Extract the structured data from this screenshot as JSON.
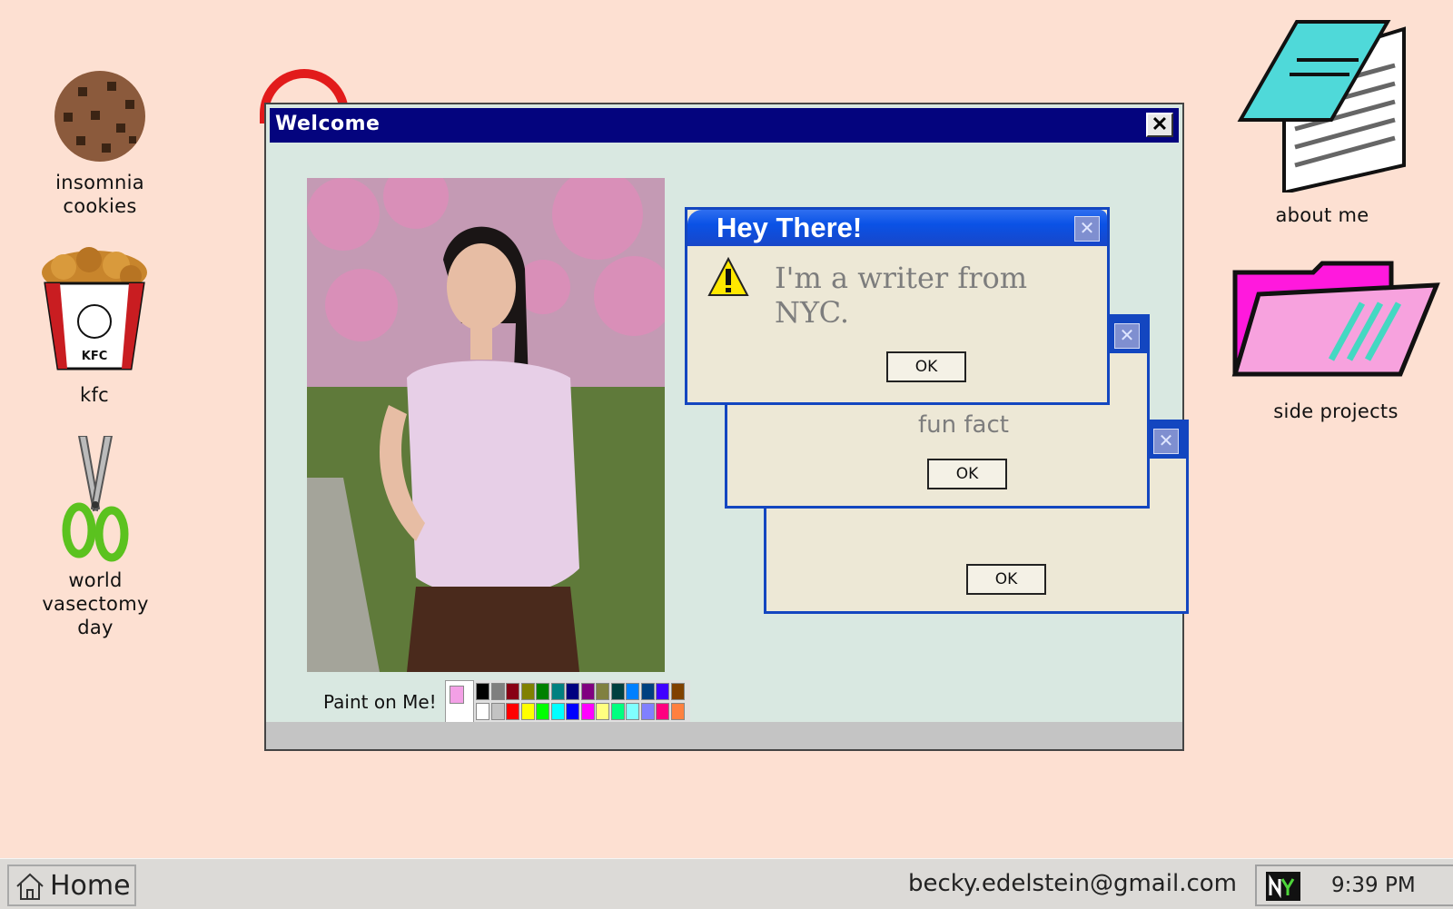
{
  "desktop_icons": {
    "cookies": {
      "label_line1": "insomnia",
      "label_line2": "cookies"
    },
    "kfc": {
      "label": "kfc",
      "bucket_text": "KFC"
    },
    "vasectomy": {
      "label_line1": "world",
      "label_line2": "vasectomy",
      "label_line3": "day"
    },
    "about": {
      "label": "about me"
    },
    "projects": {
      "label": "side projects"
    }
  },
  "welcome_window": {
    "title": "Welcome",
    "close_glyph": "✕",
    "paint_label": "Paint on Me!",
    "palette_colors": [
      "#000000",
      "#7f7f7f",
      "#880015",
      "#808000",
      "#008000",
      "#008080",
      "#000080",
      "#800080",
      "#808040",
      "#004040",
      "#0080ff",
      "#004080",
      "#4000ff",
      "#804000",
      "#ffffff",
      "#c3c3c3",
      "#ff0000",
      "#ffff00",
      "#00ff00",
      "#00ffff",
      "#0000ff",
      "#ff00ff",
      "#ffff80",
      "#00ff80",
      "#80ffff",
      "#8080ff",
      "#ff0080",
      "#ff8040"
    ]
  },
  "dialogs": {
    "hey": {
      "title": "Hey There!",
      "message": "I'm a writer from NYC.",
      "ok": "OK"
    },
    "fun": {
      "message": "fun fact",
      "ok": "OK"
    },
    "third": {
      "ok": "OK"
    }
  },
  "taskbar": {
    "home_label": "Home",
    "email": "becky.edelstein@gmail.com",
    "clock": "9:39 PM"
  },
  "colors": {
    "background": "#fde0d2",
    "titlebar": "#04047e",
    "dialog_border": "#1346c0"
  }
}
